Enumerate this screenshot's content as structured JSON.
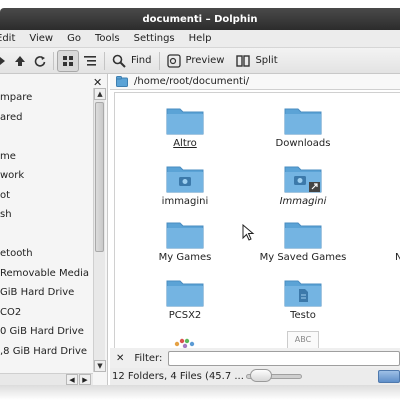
{
  "window": {
    "title": "documenti – Dolphin"
  },
  "menu": [
    "Edit",
    "View",
    "Go",
    "Tools",
    "Settings",
    "Help"
  ],
  "toolbar": {
    "find_label": "Find",
    "preview_label": "Preview",
    "split_label": "Split"
  },
  "sidebar": {
    "items": [
      "mpare",
      "ared",
      "",
      "me",
      "work",
      "ot",
      "sh",
      "",
      "etooth",
      "Removable Media",
      "GiB Hard Drive",
      "CO2",
      "0 GiB Hard Drive",
      ",8 GiB Hard Drive"
    ]
  },
  "location": {
    "path": "/home/root/documenti/"
  },
  "files": [
    {
      "name": "Altro",
      "icon": "folder-icon"
    },
    {
      "name": "Downloads",
      "icon": "folder-icon"
    },
    {
      "name": "immagini",
      "icon": "folder-camera-icon"
    },
    {
      "name": "Immagini",
      "icon": "folder-camera-link-icon"
    },
    {
      "name": "My Games",
      "icon": "folder-icon"
    },
    {
      "name": "My Saved Games",
      "icon": "folder-icon"
    },
    {
      "name": "N",
      "icon": "folder-icon"
    },
    {
      "name": "PCSX2",
      "icon": "folder-icon"
    },
    {
      "name": "Testo",
      "icon": "folder-document-icon"
    },
    {
      "name": "",
      "icon": "color-dots-icon"
    },
    {
      "name": "ABC",
      "icon": "text-file-icon"
    }
  ],
  "filter": {
    "label": "Filter:",
    "value": ""
  },
  "status": {
    "text": "12 Folders, 4 Files (45.7 ..."
  },
  "colors": {
    "folder": "#5ba3d6",
    "titlebar": "#333333",
    "accent": "#5f8fc9"
  }
}
